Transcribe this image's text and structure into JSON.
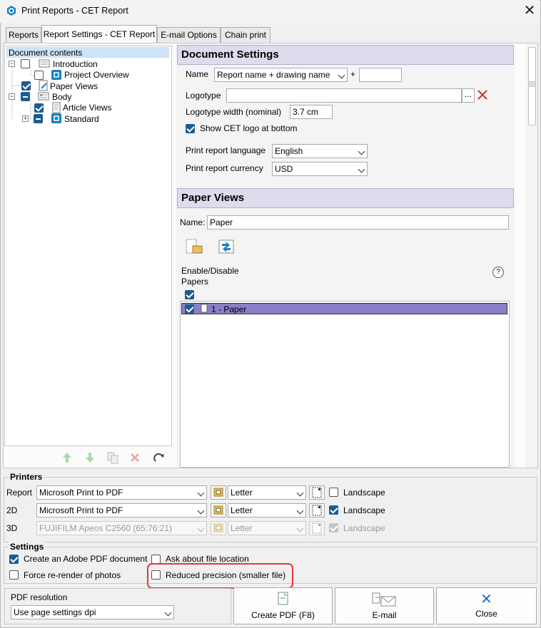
{
  "window": {
    "title": "Print Reports - CET Report",
    "close_glyph": "✕"
  },
  "tabs": [
    {
      "label": "Reports"
    },
    {
      "label": "Report Settings - CET Report"
    },
    {
      "label": "E-mail Options"
    },
    {
      "label": "Chain print"
    }
  ],
  "tree": {
    "header": "Document contents",
    "items": [
      {
        "label": "Introduction"
      },
      {
        "label": "Project Overview"
      },
      {
        "label": "Paper Views"
      },
      {
        "label": "Body"
      },
      {
        "label": "Article Views"
      },
      {
        "label": "Standard"
      }
    ]
  },
  "document_settings": {
    "header": "Document Settings",
    "name_label": "Name",
    "name_value": "Report name + drawing name",
    "plus": "+",
    "name_suffix": "",
    "logotype_label": "Logotype",
    "logotype_value": "",
    "browse_glyph": "...",
    "logotype_width_label": "Logotype width (nominal)",
    "logotype_width_value": "3.7 cm",
    "show_logo_label": "Show CET logo at bottom",
    "language_label": "Print report language",
    "language_value": "English",
    "currency_label": "Print report currency",
    "currency_value": "USD"
  },
  "paper_views": {
    "header": "Paper Views",
    "name_label": "Name:",
    "name_value": "Paper",
    "enable_label_1": "Enable/Disable",
    "enable_label_2": "Papers",
    "help_glyph": "?",
    "papers": [
      {
        "label": "1 - Paper"
      }
    ]
  },
  "printers": {
    "title": "Printers",
    "rows": [
      {
        "label": "Report",
        "printer": "Microsoft Print to PDF",
        "paper": "Letter",
        "landscape_label": "Landscape"
      },
      {
        "label": "2D",
        "printer": "Microsoft Print to PDF",
        "paper": "Letter",
        "landscape_label": "Landscape"
      },
      {
        "label": "3D",
        "printer": "FUJIFILM Apeos C2560 (65:76:21)",
        "paper": "Letter",
        "landscape_label": "Landscape"
      }
    ]
  },
  "settings": {
    "title": "Settings",
    "create_pdf_label": "Create an Adobe PDF document",
    "ask_location_label": "Ask about file location",
    "force_rerender_label": "Force re-render of photos",
    "reduced_precision_label": "Reduced precision (smaller file)"
  },
  "pdf_resolution": {
    "label": "PDF resolution",
    "value": "Use page settings dpi"
  },
  "buttons": {
    "create_pdf": "Create PDF (F8)",
    "email": "E-mail",
    "close": "Close",
    "close_glyph": "✕"
  },
  "colors": {
    "accent": "#1e5c8f",
    "highlight": "#e53935",
    "header_bg": "#dcdcec",
    "selected_row": "#8a7fc7"
  }
}
